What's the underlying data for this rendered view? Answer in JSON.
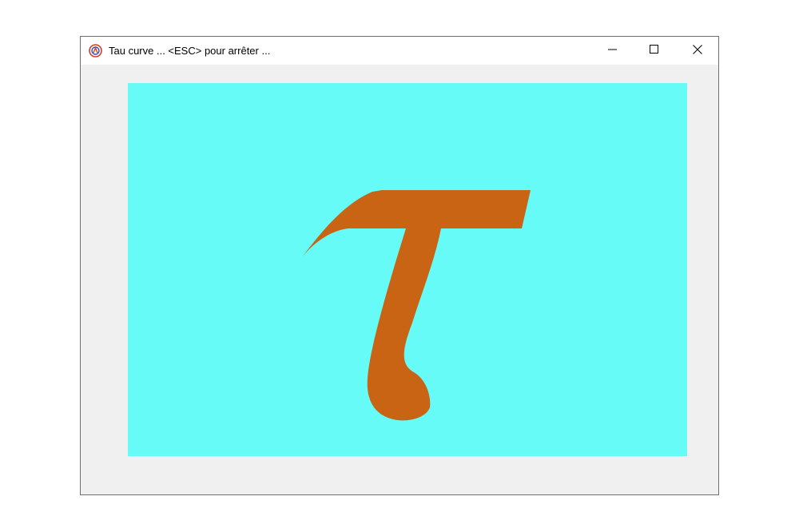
{
  "window": {
    "title": "Tau curve ... <ESC> pour arrêter ...",
    "icon": "app-logo-icon",
    "controls": {
      "minimize": "minimize-icon",
      "maximize": "maximize-icon",
      "close": "close-icon"
    }
  },
  "canvas": {
    "background_color": "#66fbf7",
    "glyph": "τ",
    "glyph_color": "#c96414"
  }
}
